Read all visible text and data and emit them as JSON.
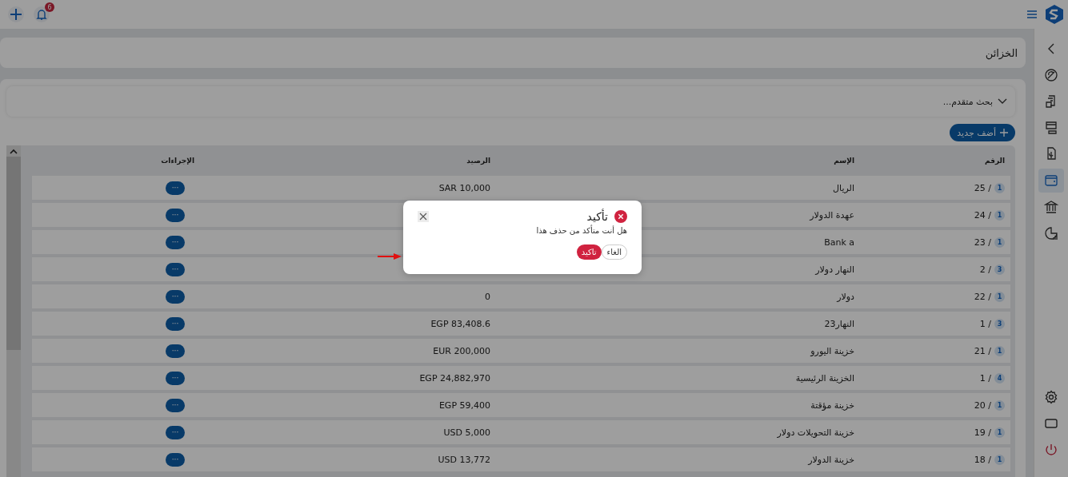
{
  "top_bar": {
    "notification_count": "6"
  },
  "page_title": "الخزائن",
  "advanced_search": {
    "label": "بحث متقدم...",
    "expanded": false
  },
  "add_button": {
    "label": "أضف جديد"
  },
  "table": {
    "columns": [
      "الرقم",
      "الإسم",
      "الرصيد",
      "الإجراءات"
    ],
    "rows": [
      {
        "badge": "1",
        "number": "25 /",
        "name": "الريال",
        "balance": "SAR 10,000",
        "action": "···"
      },
      {
        "badge": "1",
        "number": "24 /",
        "name": "عهدة الدولار",
        "action": "···"
      },
      {
        "badge": "1",
        "number": "23 /",
        "name": "Bank a",
        "action": "···"
      },
      {
        "badge": "3",
        "number": "2 /",
        "name": "النهار دولار",
        "action": "···"
      },
      {
        "badge": "1",
        "number": "22 /",
        "name": "دولار",
        "balance": "0",
        "action": "···"
      },
      {
        "badge": "3",
        "number": "1 /",
        "name": "النهار23",
        "balance": "EGP 83,408.6",
        "action": "···"
      },
      {
        "badge": "1",
        "number": "21 /",
        "name": "خزينة اليورو",
        "balance": "EUR 200,000",
        "action": "···"
      },
      {
        "badge": "4",
        "number": "1 /",
        "name": "الخزينة الرئيسية",
        "balance": "EGP 24,882,970",
        "action": "···"
      },
      {
        "badge": "1",
        "number": "20 /",
        "name": "خزينة مؤقتة",
        "balance": "EGP 59,400",
        "action": "···"
      },
      {
        "badge": "1",
        "number": "19 /",
        "name": "خزينة التحويلات دولار",
        "balance": "USD 5,000",
        "action": "···"
      },
      {
        "badge": "1",
        "number": "18 /",
        "name": "خزينة الدولار",
        "balance": "USD 13,772",
        "action": "···"
      }
    ]
  },
  "sidebar": {
    "items": [
      {
        "selected": false
      },
      {
        "selected": false
      },
      {
        "selected": false
      },
      {
        "selected": false
      },
      {
        "selected": true
      },
      {
        "selected": false
      },
      {
        "selected": false
      }
    ]
  },
  "dialog": {
    "title": "تأكيد",
    "message": "هل أنت متأكد من حذف هذا",
    "buttons": [
      {
        "label": "الغاء",
        "kind": "secondary"
      },
      {
        "label": "تاكيد",
        "kind": "primary"
      }
    ]
  }
}
